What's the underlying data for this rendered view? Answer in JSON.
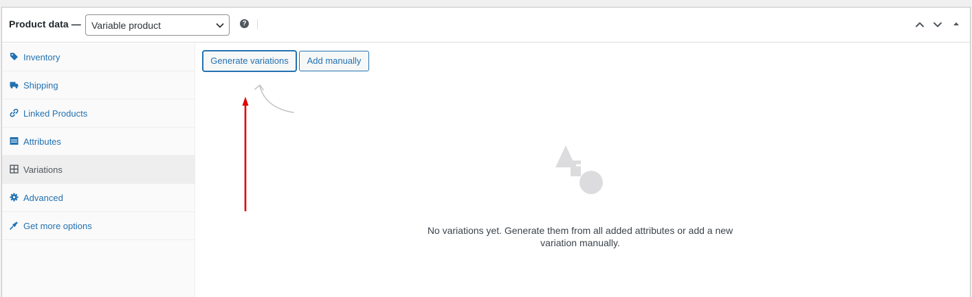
{
  "header": {
    "title": "Product data —",
    "product_type": {
      "selected": "Variable product"
    },
    "help_icon": "help-icon",
    "controls": [
      "move-up-icon",
      "move-down-icon",
      "toggle-panel-icon"
    ]
  },
  "sidebar": {
    "items": [
      {
        "label": "Inventory",
        "icon": "tag-icon",
        "active": false
      },
      {
        "label": "Shipping",
        "icon": "truck-icon",
        "active": false
      },
      {
        "label": "Linked Products",
        "icon": "link-icon",
        "active": false
      },
      {
        "label": "Attributes",
        "icon": "list-icon",
        "active": false
      },
      {
        "label": "Variations",
        "icon": "grid-icon",
        "active": true
      },
      {
        "label": "Advanced",
        "icon": "gear-icon",
        "active": false
      },
      {
        "label": "Get more options",
        "icon": "plug-icon",
        "active": false
      }
    ]
  },
  "main": {
    "generate_label": "Generate variations",
    "add_manually_label": "Add manually",
    "empty_message": "No variations yet. Generate them from all added attributes or add a new variation manually.",
    "empty_icon": "shapes-icon"
  },
  "annotation": {
    "color": "#e00000"
  },
  "colors": {
    "link": "#2271b1",
    "border": "#c3c4c7",
    "muted_icon": "#dcdcde"
  }
}
